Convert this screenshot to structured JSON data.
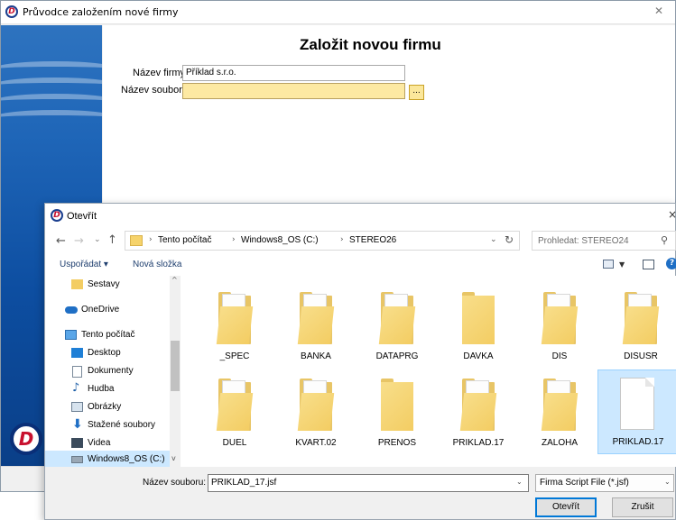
{
  "wizard": {
    "title": "Průvodce založením nové firmy",
    "heading": "Založit novou firmu",
    "company_name_label": "Název firmy:",
    "company_name_value": "Příklad s.r.o.",
    "file_name_label": "Název souboru:",
    "file_name_value": "",
    "browse_label": "..."
  },
  "dialog": {
    "title": "Otevřít",
    "breadcrumbs": [
      "Tento počítač",
      "Windows8_OS (C:)",
      "STEREO26"
    ],
    "search_placeholder": "Prohledat: STEREO24",
    "toolbar": {
      "organize": "Uspořádat ▾",
      "new_folder": "Nová složka"
    },
    "nav_items": [
      {
        "label": "Sestavy",
        "icon": "folder-icon"
      },
      {
        "label": "OneDrive",
        "icon": "onedrive-icon"
      },
      {
        "label": "Tento počítač",
        "icon": "computer-icon"
      },
      {
        "label": "Desktop",
        "icon": "desktop-icon"
      },
      {
        "label": "Dokumenty",
        "icon": "documents-icon"
      },
      {
        "label": "Hudba",
        "icon": "music-icon"
      },
      {
        "label": "Obrázky",
        "icon": "pictures-icon"
      },
      {
        "label": "Stažené soubory",
        "icon": "downloads-icon"
      },
      {
        "label": "Videa",
        "icon": "videos-icon"
      },
      {
        "label": "Windows8_OS (C:)",
        "icon": "drive-icon",
        "selected": true
      }
    ],
    "files": [
      {
        "name": "_SPEC",
        "type": "folder"
      },
      {
        "name": "BANKA",
        "type": "folder"
      },
      {
        "name": "DATAPRG",
        "type": "folder"
      },
      {
        "name": "DAVKA",
        "type": "folder"
      },
      {
        "name": "DIS",
        "type": "folder"
      },
      {
        "name": "DISUSR",
        "type": "folder"
      },
      {
        "name": "DUEL",
        "type": "folder"
      },
      {
        "name": "KVART.02",
        "type": "folder"
      },
      {
        "name": "PRENOS",
        "type": "folder"
      },
      {
        "name": "PRIKLAD.17",
        "type": "folder"
      },
      {
        "name": "ZALOHA",
        "type": "folder"
      },
      {
        "name": "PRIKLAD.17",
        "type": "file",
        "selected": true
      }
    ],
    "file_name_label": "Název souboru:",
    "file_name_value": "PRIKLAD_17.jsf",
    "file_type": "Firma Script File (*.jsf)",
    "open_button": "Otevřít",
    "cancel_button": "Zrušit"
  },
  "colors": {
    "accent": "#0078d7",
    "selection": "#cce8ff",
    "folder": "#f3cd63",
    "sidebar_blue": "#1f66b8"
  }
}
